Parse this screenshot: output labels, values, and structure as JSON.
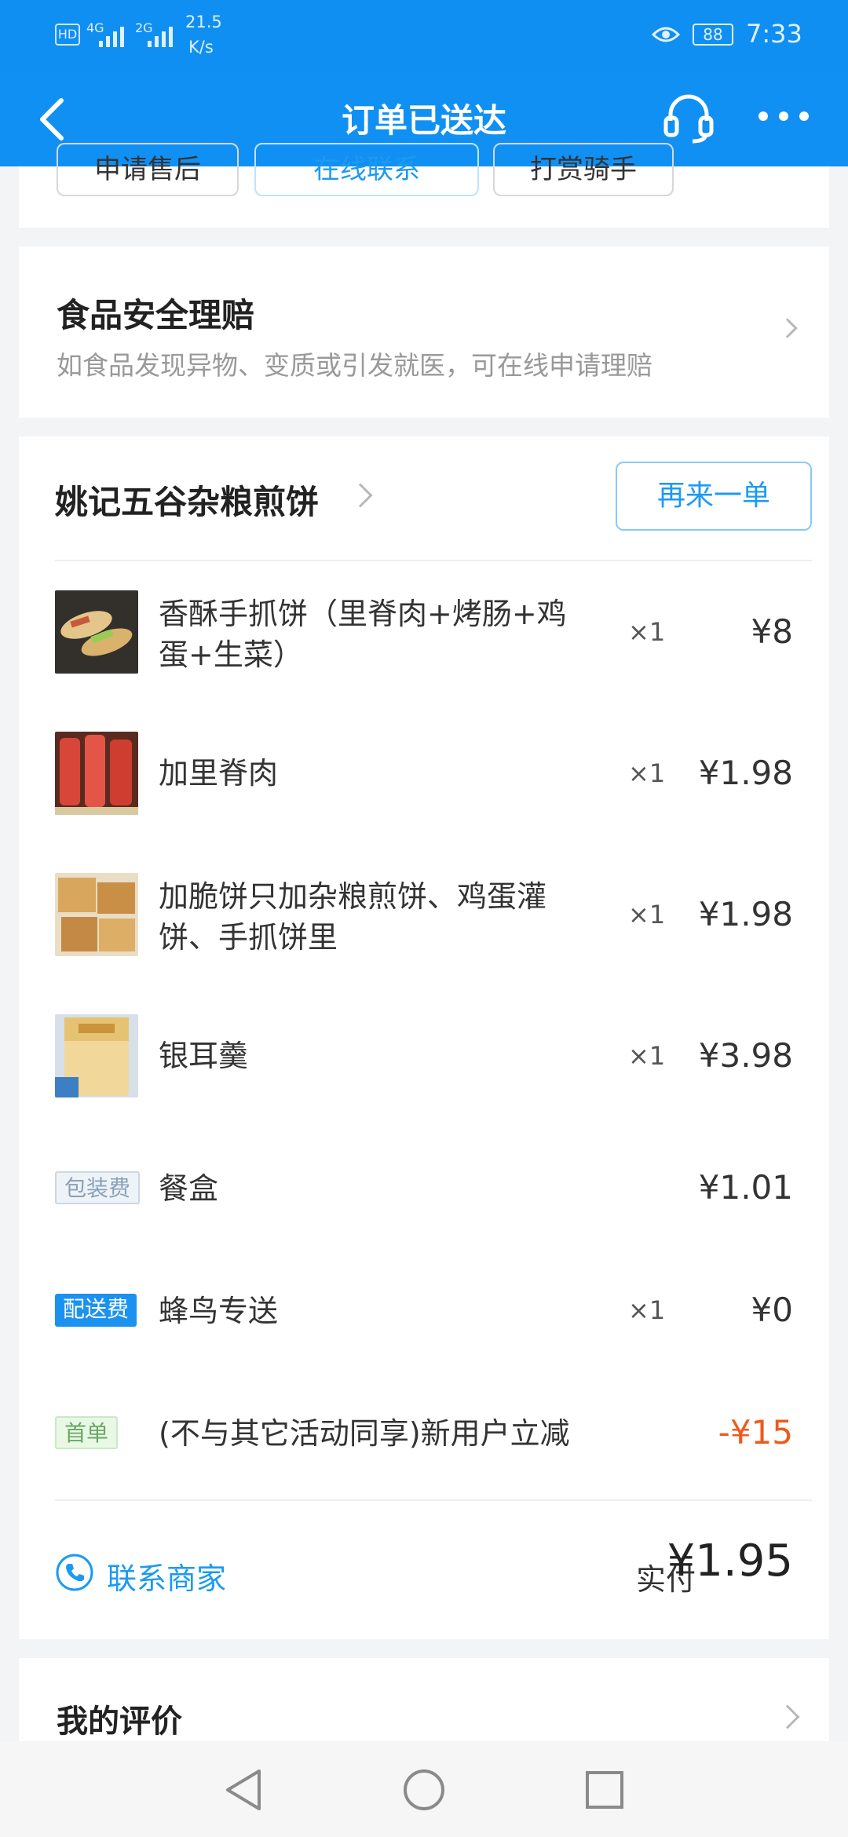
{
  "status_bar": {
    "hd": "HD",
    "signal1": "4G",
    "signal2": "2G",
    "speed": "21.5",
    "speed_unit": "K/s",
    "battery": "88",
    "time": "7:33"
  },
  "nav": {
    "title": "订单已送达"
  },
  "top_actions": {
    "buttons": [
      "申请售后",
      "在线联系",
      "打赏骑手"
    ]
  },
  "safety": {
    "title": "食品安全理赔",
    "subtitle": "如食品发现异物、变质或引发就医，可在线申请理赔"
  },
  "order": {
    "shop_name": "姚记五谷杂粮煎饼",
    "reorder_label": "再来一单",
    "items": [
      {
        "name": "香酥手抓饼（里脊肉+烤肠+鸡蛋+生菜）",
        "qty": "×1",
        "price": "¥8"
      },
      {
        "name": "加里脊肉",
        "qty": "×1",
        "price": "¥1.98"
      },
      {
        "name": "加脆饼只加杂粮煎饼、鸡蛋灌饼、手抓饼里",
        "qty": "×1",
        "price": "¥1.98"
      },
      {
        "name": "银耳羹",
        "qty": "×1",
        "price": "¥3.98"
      }
    ],
    "fees": [
      {
        "tag": "包装费",
        "name": "餐盒",
        "qty": "",
        "price": "¥1.01"
      },
      {
        "tag": "配送费",
        "name": "蜂鸟专送",
        "qty": "×1",
        "price": "¥0"
      },
      {
        "tag": "首单",
        "name": "(不与其它活动同享)新用户立减",
        "qty": "",
        "price": "-¥15"
      }
    ],
    "contact_label": "联系商家",
    "paid_label": "实付",
    "paid_value": "¥1.95"
  },
  "review": {
    "title": "我的评价"
  },
  "colors": {
    "brand_blue": "#1190f3",
    "discount_red": "#ee5a1c"
  }
}
